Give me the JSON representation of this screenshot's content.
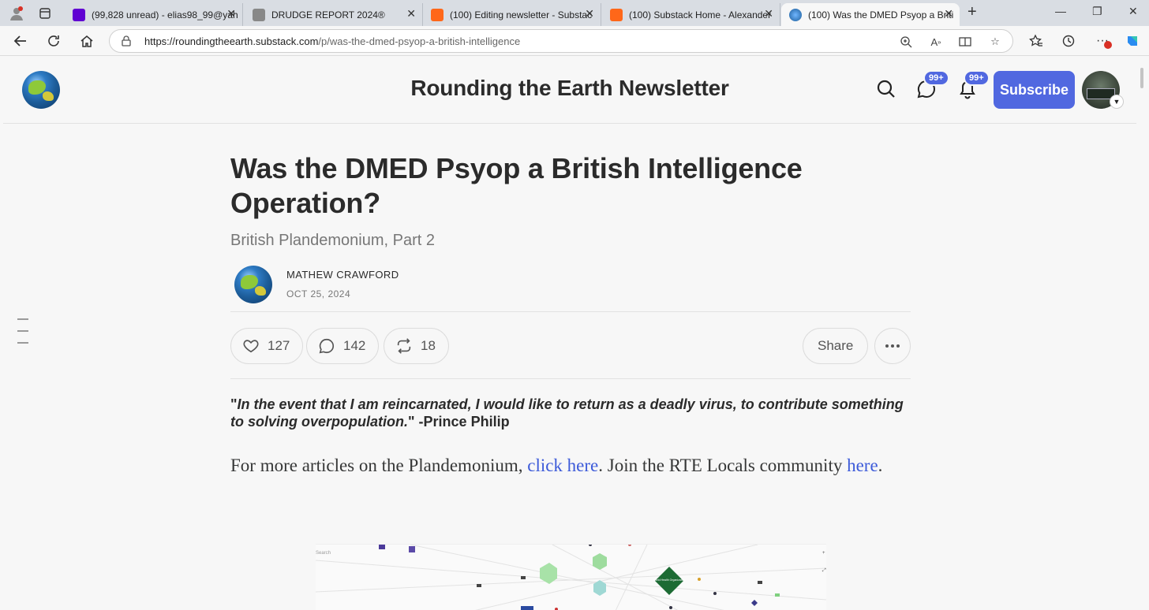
{
  "browser": {
    "tabs": [
      {
        "title": "(99,828 unread) - elias98_99@yah",
        "favicon": "mail-icon",
        "active": false
      },
      {
        "title": "DRUDGE REPORT 2024®",
        "favicon": "drudge-icon",
        "active": false
      },
      {
        "title": "(100) Editing newsletter - Substac",
        "favicon": "substack-icon",
        "active": false
      },
      {
        "title": "(100) Substack Home - Alexander",
        "favicon": "substack-icon",
        "active": false
      },
      {
        "title": "(100) Was the DMED Psyop a Briti",
        "favicon": "globe-icon",
        "active": true
      }
    ],
    "url_host": "https://roundingtheearth.substack.com",
    "url_path": "/p/was-the-dmed-psyop-a-british-intelligence",
    "accent": "#5168e0"
  },
  "site": {
    "title": "Rounding the Earth Newsletter",
    "chat_badge": "99+",
    "notif_badge": "99+",
    "subscribe_label": "Subscribe"
  },
  "post": {
    "title": "Was the DMED Psyop a British Intelligence Operation?",
    "subtitle": "British Plandemonium, Part 2",
    "author": "MATHEW CRAWFORD",
    "date": "OCT 25, 2024",
    "likes": "127",
    "comments": "142",
    "restacks": "18",
    "share_label": "Share",
    "quote_open": "\"",
    "quote_text": "In the event that I am reincarnated, I would like to return as a deadly virus, to contribute something to solving overpopulation.",
    "quote_close": "\"",
    "quote_attribution": " -Prince Philip",
    "body_prefix": "For more articles on the Plandemonium, ",
    "body_link1": "click here",
    "body_middle": ". Join the RTE Locals community ",
    "body_link2": "here",
    "body_suffix": "."
  },
  "map": {
    "search_label": "Search",
    "node_label": "World Health Organization"
  }
}
